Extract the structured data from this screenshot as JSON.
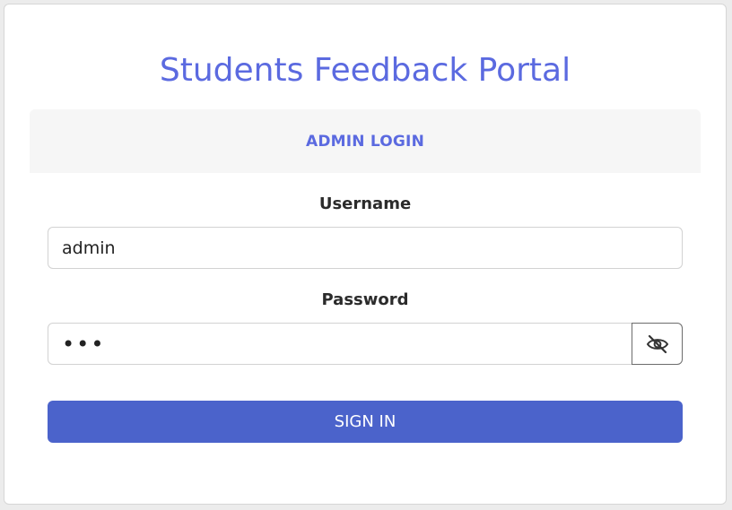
{
  "portal": {
    "title": "Students Feedback Portal"
  },
  "login_header": {
    "label": "ADMIN LOGIN"
  },
  "username": {
    "label": "Username",
    "value": "admin"
  },
  "password": {
    "label": "Password",
    "value": "•••",
    "toggle_icon": "eye-slash-icon"
  },
  "signin": {
    "label": "SIGN IN"
  },
  "colors": {
    "accent": "#5b6ae0",
    "button": "#4b63cb",
    "header_bg": "#f6f6f6"
  }
}
